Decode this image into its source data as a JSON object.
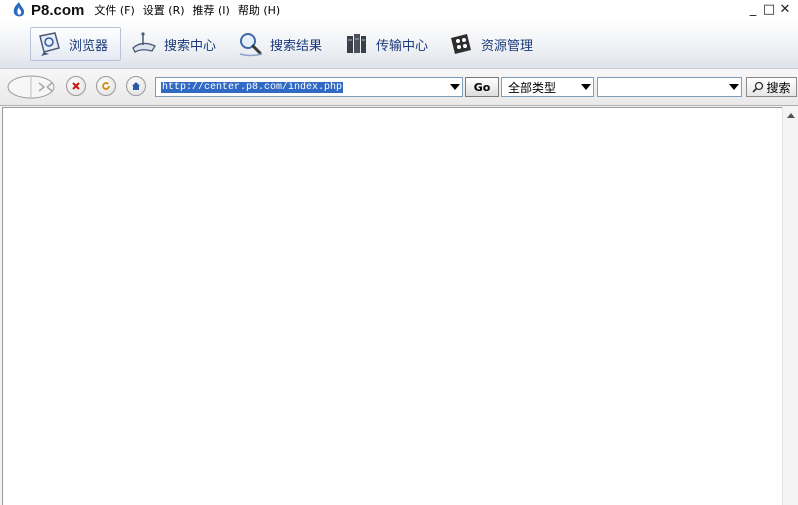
{
  "app": {
    "logo_text": "P8.com"
  },
  "menu": [
    {
      "label": "文件 (F)"
    },
    {
      "label": "设置 (R)"
    },
    {
      "label": "推荐 (I)"
    },
    {
      "label": "帮助 (H)"
    }
  ],
  "window_controls": {
    "minimize": "_",
    "maximize": "□",
    "close": "✕"
  },
  "nav_tabs": [
    {
      "label": "浏览器",
      "icon": "browser-icon",
      "active": true
    },
    {
      "label": "搜索中心",
      "icon": "satellite-dish-icon",
      "active": false
    },
    {
      "label": "搜索结果",
      "icon": "magnifier-icon",
      "active": false
    },
    {
      "label": "传输中心",
      "icon": "server-icon",
      "active": false
    },
    {
      "label": "资源管理",
      "icon": "film-reel-icon",
      "active": false
    }
  ],
  "addressbar": {
    "url": "http://center.p8.com/index.php",
    "go_label": "Go",
    "type_selected": "全部类型",
    "keyword_value": "",
    "search_label": "搜索"
  },
  "colors": {
    "nav_text": "#1b3a7a",
    "selection": "#316ac5",
    "input_border": "#7f9db9"
  }
}
